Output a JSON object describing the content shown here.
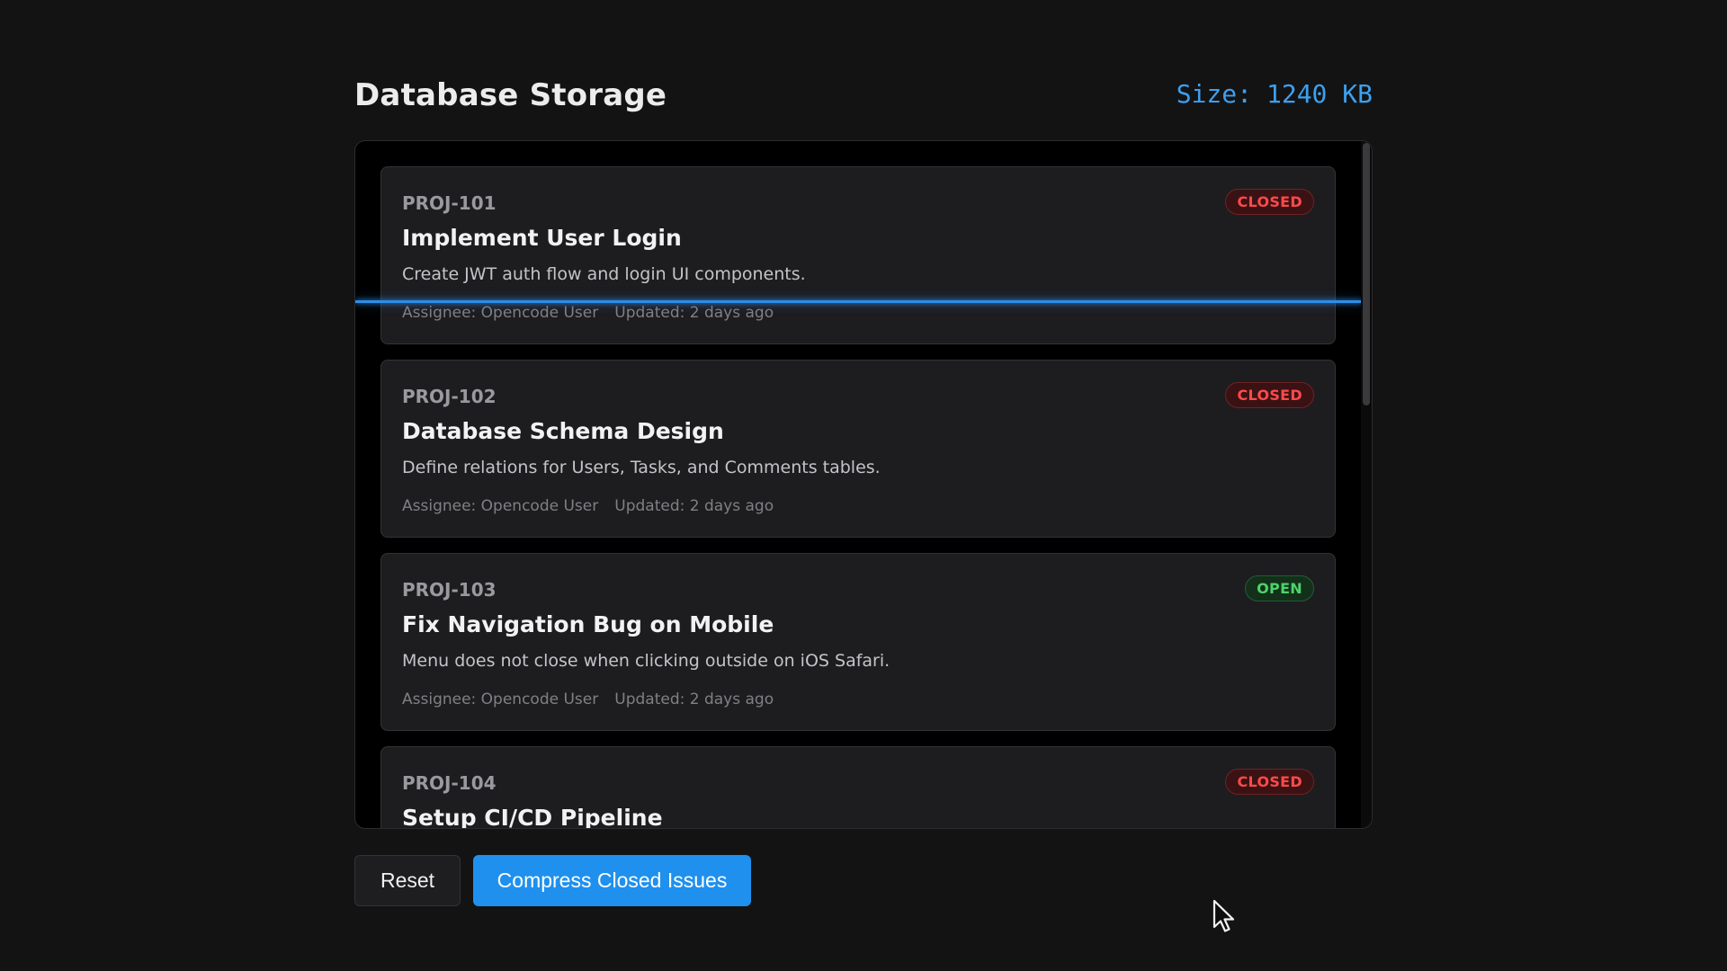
{
  "header": {
    "title": "Database Storage",
    "size_label": "Size:",
    "size_value": "1240 KB"
  },
  "colors": {
    "accent": "#1f90ee",
    "size_text": "#3da0f0",
    "closed": "#ff4a4a",
    "open": "#4dd36a"
  },
  "issues": [
    {
      "id": "PROJ-101",
      "status": "CLOSED",
      "title": "Implement User Login",
      "description": "Create JWT auth flow and login UI components.",
      "assignee": "Assignee: Opencode User",
      "updated": "Updated: 2 days ago"
    },
    {
      "id": "PROJ-102",
      "status": "CLOSED",
      "title": "Database Schema Design",
      "description": "Define relations for Users, Tasks, and Comments tables.",
      "assignee": "Assignee: Opencode User",
      "updated": "Updated: 2 days ago"
    },
    {
      "id": "PROJ-103",
      "status": "OPEN",
      "title": "Fix Navigation Bug on Mobile",
      "description": "Menu does not close when clicking outside on iOS Safari.",
      "assignee": "Assignee: Opencode User",
      "updated": "Updated: 2 days ago"
    },
    {
      "id": "PROJ-104",
      "status": "CLOSED",
      "title": "Setup CI/CD Pipeline",
      "description": "",
      "assignee": "",
      "updated": ""
    }
  ],
  "actions": {
    "reset_label": "Reset",
    "compress_label": "Compress Closed Issues"
  },
  "icons": {
    "cursor": "cursor-arrow-icon"
  }
}
